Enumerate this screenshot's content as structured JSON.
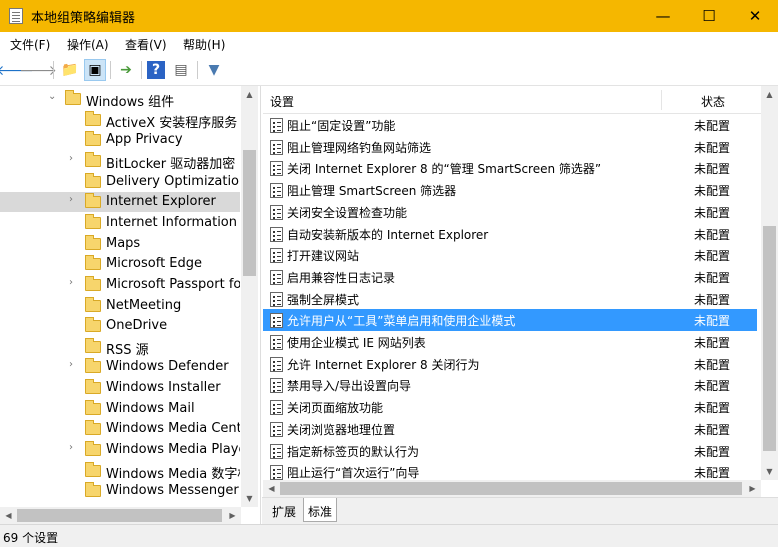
{
  "window": {
    "title": "本地组策略编辑器",
    "minimize": "—",
    "maximize": "☐",
    "close": "✕"
  },
  "menu": [
    "文件(F)",
    "操作(A)",
    "查看(V)",
    "帮助(H)"
  ],
  "toolbar": {
    "back": "🡐",
    "forward": "🡒",
    "up": "📁",
    "show_hide": "▣",
    "export": "➔",
    "help": "?",
    "properties": "▤",
    "filter": "▼"
  },
  "tree": {
    "items": [
      {
        "label": "Windows 组件",
        "expander": "⌄"
      },
      {
        "label": "ActiveX 安装程序服务",
        "expander": ""
      },
      {
        "label": "App Privacy",
        "expander": ""
      },
      {
        "label": "BitLocker 驱动器加密",
        "expander": "›"
      },
      {
        "label": "Delivery Optimization",
        "expander": ""
      },
      {
        "label": "Internet Explorer",
        "expander": "›"
      },
      {
        "label": "Internet Information S",
        "expander": ""
      },
      {
        "label": "Maps",
        "expander": ""
      },
      {
        "label": "Microsoft Edge",
        "expander": ""
      },
      {
        "label": "Microsoft Passport for",
        "expander": "›"
      },
      {
        "label": "NetMeeting",
        "expander": ""
      },
      {
        "label": "OneDrive",
        "expander": ""
      },
      {
        "label": "RSS 源",
        "expander": ""
      },
      {
        "label": "Windows Defender",
        "expander": "›"
      },
      {
        "label": "Windows Installer",
        "expander": ""
      },
      {
        "label": "Windows Mail",
        "expander": ""
      },
      {
        "label": "Windows Media Cente",
        "expander": ""
      },
      {
        "label": "Windows Media Playe",
        "expander": "›"
      },
      {
        "label": "Windows Media 数字权",
        "expander": ""
      },
      {
        "label": "Windows Messenger",
        "expander": ""
      }
    ],
    "selected": "Internet Explorer"
  },
  "list": {
    "header": {
      "name": "设置",
      "state": "状态"
    },
    "rows": [
      {
        "name": "阻止“固定设置”功能",
        "state": "未配置"
      },
      {
        "name": "阻止管理网络钓鱼网站筛选",
        "state": "未配置"
      },
      {
        "name": "关闭 Internet Explorer 8 的“管理 SmartScreen 筛选器”",
        "state": "未配置"
      },
      {
        "name": "阻止管理 SmartScreen 筛选器",
        "state": "未配置"
      },
      {
        "name": "关闭安全设置检查功能",
        "state": "未配置"
      },
      {
        "name": "自动安装新版本的 Internet Explorer",
        "state": "未配置"
      },
      {
        "name": "打开建议网站",
        "state": "未配置"
      },
      {
        "name": "启用兼容性日志记录",
        "state": "未配置"
      },
      {
        "name": "强制全屏模式",
        "state": "未配置"
      },
      {
        "name": "允许用户从“工具”菜单启用和使用企业模式",
        "state": "未配置"
      },
      {
        "name": "使用企业模式 IE 网站列表",
        "state": "未配置"
      },
      {
        "name": "允许 Internet Explorer 8 关闭行为",
        "state": "未配置"
      },
      {
        "name": "禁用导入/导出设置向导",
        "state": "未配置"
      },
      {
        "name": "关闭页面缩放功能",
        "state": "未配置"
      },
      {
        "name": "关闭浏览器地理位置",
        "state": "未配置"
      },
      {
        "name": "指定新标签页的默认行为",
        "state": "未配置"
      },
      {
        "name": "阻止运行“首次运行”向导",
        "state": "未配置"
      }
    ],
    "selected_index": 9
  },
  "tabs": [
    "扩展",
    "标准"
  ],
  "active_tab": "标准",
  "status": "69 个设置",
  "colors": {
    "titlebar": "#f5b700",
    "selection": "#3399ff"
  }
}
